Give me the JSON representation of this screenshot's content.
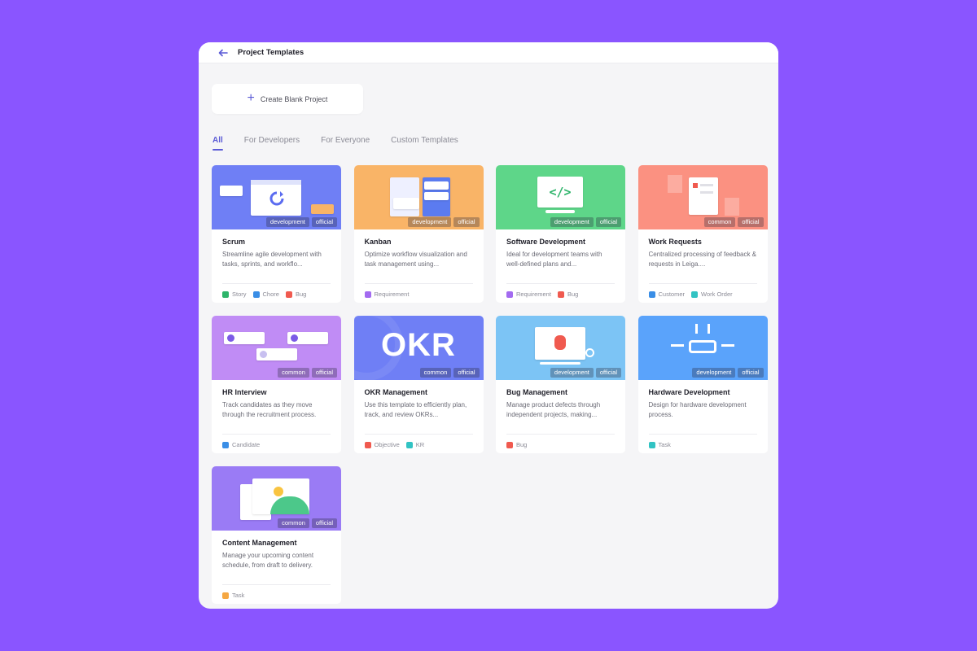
{
  "header": {
    "title": "Project Templates"
  },
  "create_blank": {
    "label": "Create Blank Project"
  },
  "tabs": [
    {
      "label": "All",
      "active": true
    },
    {
      "label": "For Developers",
      "active": false
    },
    {
      "label": "For Everyone",
      "active": false
    },
    {
      "label": "Custom Templates",
      "active": false
    }
  ],
  "colors": {
    "accent": "#5b5bd6",
    "background": "#8a55ff"
  },
  "templates": [
    {
      "id": "scrum",
      "title": "Scrum",
      "desc": "Streamline agile development with tasks, sprints, and workflo...",
      "category": "development",
      "official": "official",
      "banner_color": "#6f7ff5",
      "types": [
        {
          "label": "Story",
          "icon": "story-icon",
          "color": "#2db46a"
        },
        {
          "label": "Chore",
          "icon": "chore-icon",
          "color": "#3a8ee6"
        },
        {
          "label": "Bug",
          "icon": "bug-icon",
          "color": "#f05a4f"
        }
      ]
    },
    {
      "id": "kanban",
      "title": "Kanban",
      "desc": "Optimize workflow visualization and task management using...",
      "category": "development",
      "official": "official",
      "banner_color": "#f9b467",
      "types": [
        {
          "label": "Requirement",
          "icon": "requirement-icon",
          "color": "#a36bf0"
        }
      ]
    },
    {
      "id": "software-development",
      "title": "Software Development",
      "desc": "Ideal for development teams with well-defined plans and...",
      "category": "development",
      "official": "official",
      "banner_color": "#5ed689",
      "types": [
        {
          "label": "Requirement",
          "icon": "requirement-icon",
          "color": "#a36bf0"
        },
        {
          "label": "Bug",
          "icon": "bug-icon",
          "color": "#f05a4f"
        }
      ]
    },
    {
      "id": "work-requests",
      "title": "Work Requests",
      "desc": "Centralized processing of feedback & requests in Leiga....",
      "category": "common",
      "official": "official",
      "banner_color": "#fb9181",
      "types": [
        {
          "label": "Customer",
          "icon": "customer-icon",
          "color": "#3a8ee6"
        },
        {
          "label": "Work Order",
          "icon": "work-order-icon",
          "color": "#32c3c3"
        }
      ]
    },
    {
      "id": "hr-interview",
      "title": "HR Interview",
      "desc": "Track candidates as they move through the recruitment process.",
      "category": "common",
      "official": "official",
      "banner_color": "#c08cf5",
      "types": [
        {
          "label": "Candidate",
          "icon": "candidate-icon",
          "color": "#3a8ee6"
        }
      ]
    },
    {
      "id": "okr-management",
      "title": "OKR Management",
      "desc": "Use this template to efficiently plan, track, and review OKRs...",
      "category": "common",
      "official": "official",
      "banner_color": "#6f7ff5",
      "banner_text": "OKR",
      "types": [
        {
          "label": "Objective",
          "icon": "objective-icon",
          "color": "#f05a4f"
        },
        {
          "label": "KR",
          "icon": "kr-icon",
          "color": "#32c3c3"
        }
      ]
    },
    {
      "id": "bug-management",
      "title": "Bug Management",
      "desc": "Manage product defects through independent projects, making...",
      "category": "development",
      "official": "official",
      "banner_color": "#7cc4f5",
      "types": [
        {
          "label": "Bug",
          "icon": "bug-icon",
          "color": "#f05a4f"
        }
      ]
    },
    {
      "id": "hardware-development",
      "title": "Hardware Development",
      "desc": "Design for hardware development process.",
      "category": "development",
      "official": "official",
      "banner_color": "#5aa3fb",
      "types": [
        {
          "label": "Task",
          "icon": "task-icon",
          "color": "#32c3c3"
        }
      ]
    },
    {
      "id": "content-management",
      "title": "Content Management",
      "desc": "Manage your upcoming content schedule, from draft to delivery.",
      "category": "common",
      "official": "official",
      "banner_color": "#9a7bf5",
      "types": [
        {
          "label": "Task",
          "icon": "task-icon",
          "color": "#f5a742"
        }
      ]
    }
  ]
}
